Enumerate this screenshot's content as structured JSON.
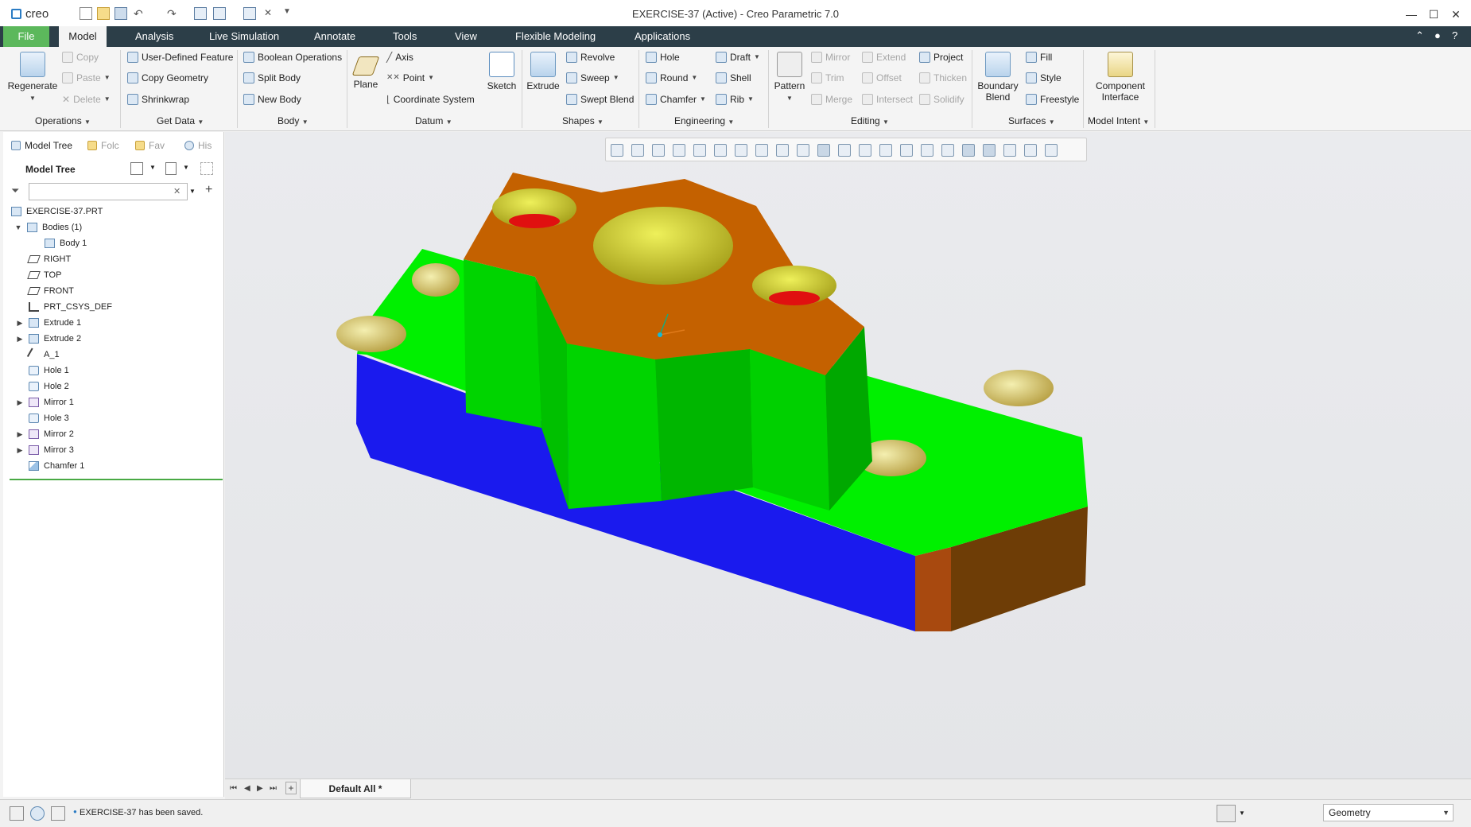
{
  "app": {
    "title": "EXERCISE-37 (Active) - Creo Parametric 7.0",
    "logo": "creo",
    "window_controls": {
      "minimize": "—",
      "maximize": "☐",
      "close": "✕"
    }
  },
  "tabs": [
    {
      "label": "File"
    },
    {
      "label": "Model"
    },
    {
      "label": "Analysis"
    },
    {
      "label": "Live Simulation"
    },
    {
      "label": "Annotate"
    },
    {
      "label": "Tools"
    },
    {
      "label": "View"
    },
    {
      "label": "Flexible Modeling"
    },
    {
      "label": "Applications"
    }
  ],
  "ribbon": {
    "operations": {
      "regenerate": "Regenerate",
      "copy": "Copy",
      "paste": "Paste",
      "delete": "Delete",
      "group": "Operations"
    },
    "get_data": {
      "udf": "User-Defined Feature",
      "copy_geometry": "Copy Geometry",
      "shrinkwrap": "Shrinkwrap",
      "group": "Get Data"
    },
    "body": {
      "boolean": "Boolean Operations",
      "split": "Split Body",
      "new": "New Body",
      "group": "Body"
    },
    "datum": {
      "plane": "Plane",
      "axis": "Axis",
      "point": "Point",
      "csys": "Coordinate System",
      "sketch": "Sketch",
      "group": "Datum"
    },
    "shapes": {
      "extrude": "Extrude",
      "revolve": "Revolve",
      "sweep": "Sweep",
      "swept_blend": "Swept Blend",
      "group": "Shapes"
    },
    "engineering": {
      "hole": "Hole",
      "round": "Round",
      "chamfer": "Chamfer",
      "draft": "Draft",
      "shell": "Shell",
      "rib": "Rib",
      "group": "Engineering"
    },
    "editing": {
      "pattern": "Pattern",
      "mirror": "Mirror",
      "trim": "Trim",
      "merge": "Merge",
      "extend": "Extend",
      "offset": "Offset",
      "intersect": "Intersect",
      "project": "Project",
      "thicken": "Thicken",
      "solidify": "Solidify",
      "group": "Editing"
    },
    "surfaces": {
      "boundary_1": "Boundary",
      "boundary_2": "Blend",
      "fill": "Fill",
      "style": "Style",
      "freestyle": "Freestyle",
      "group": "Surfaces"
    },
    "model_intent": {
      "component_1": "Component",
      "component_2": "Interface",
      "group": "Model Intent"
    }
  },
  "panel": {
    "tabs": [
      {
        "label": "Model Tree"
      },
      {
        "label": "Folc"
      },
      {
        "label": "Fav"
      },
      {
        "label": "His"
      }
    ],
    "header": "Model Tree",
    "filter_placeholder": "",
    "tree": [
      {
        "label": "EXERCISE-37.PRT"
      },
      {
        "label": "Bodies (1)"
      },
      {
        "label": "Body 1"
      },
      {
        "label": "RIGHT"
      },
      {
        "label": "TOP"
      },
      {
        "label": "FRONT"
      },
      {
        "label": "PRT_CSYS_DEF"
      },
      {
        "label": "Extrude 1"
      },
      {
        "label": "Extrude 2"
      },
      {
        "label": "A_1"
      },
      {
        "label": "Hole 1"
      },
      {
        "label": "Hole 2"
      },
      {
        "label": "Mirror 1"
      },
      {
        "label": "Hole 3"
      },
      {
        "label": "Mirror 2"
      },
      {
        "label": "Mirror 3"
      },
      {
        "label": "Chamfer 1"
      }
    ]
  },
  "viewport": {
    "sheet_tab": "Default All *",
    "colors": {
      "top_face": "#00f000",
      "front_face": "#1a1aee",
      "end_face": "#a84f00",
      "boss_top": "#c46100",
      "boss_side": "#00c800",
      "hole": "#e8dc30",
      "hole_bottom": "#e01010"
    }
  },
  "status": {
    "message": "EXERCISE-37 has been saved.",
    "selection_filter": "Geometry"
  }
}
